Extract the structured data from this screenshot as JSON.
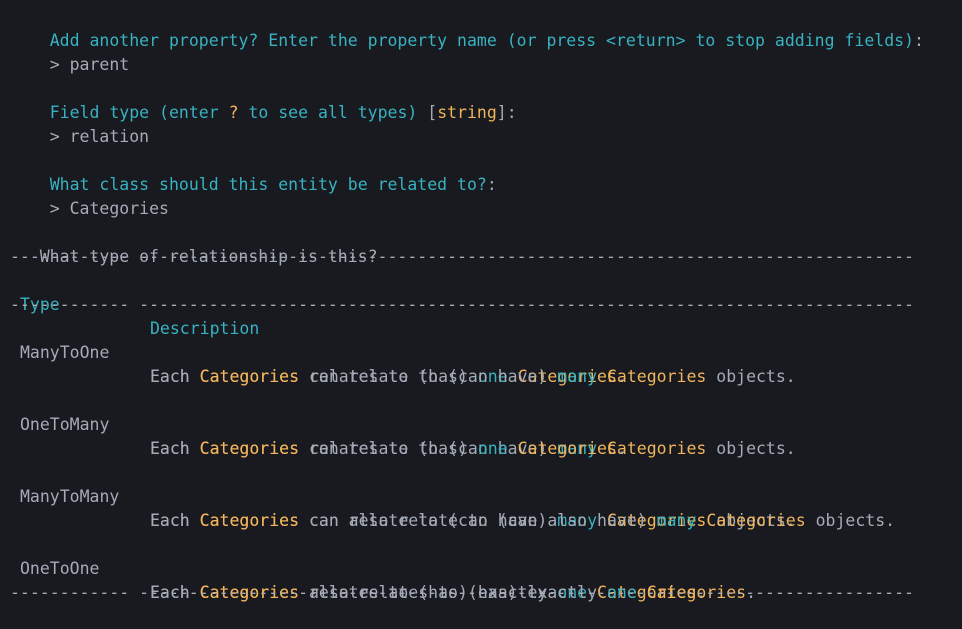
{
  "prompts": {
    "add_property": {
      "question": "Add another property? Enter the property name (or press <return> to stop adding fields)",
      "colon": ":",
      "answer": "> parent"
    },
    "field_type": {
      "q1": "Field type (enter ",
      "q_mark": "?",
      "q2": " to see all types) ",
      "bracket_open": "[",
      "default": "string",
      "bracket_close": "]:",
      "answer": "> relation"
    },
    "related_class": {
      "question": "What class should this entity be related to?",
      "colon": ":",
      "answer": "> Categories"
    }
  },
  "relationship": {
    "question": "What type of relationship is this?"
  },
  "entity": "Categories",
  "table": {
    "divider": "------------ ------------------------------------------------------------------------------",
    "headers": [
      "Type",
      "Description"
    ],
    "rows": [
      {
        "type": "ManyToOne"
      },
      {
        "type": "OneToMany"
      },
      {
        "type": "ManyToMany"
      },
      {
        "type": "OneToOne"
      }
    ]
  },
  "colors": {
    "background": "#181a20",
    "cyan": "#38b2c0",
    "yellow": "#f0b45a",
    "gray": "#a4abb6"
  }
}
